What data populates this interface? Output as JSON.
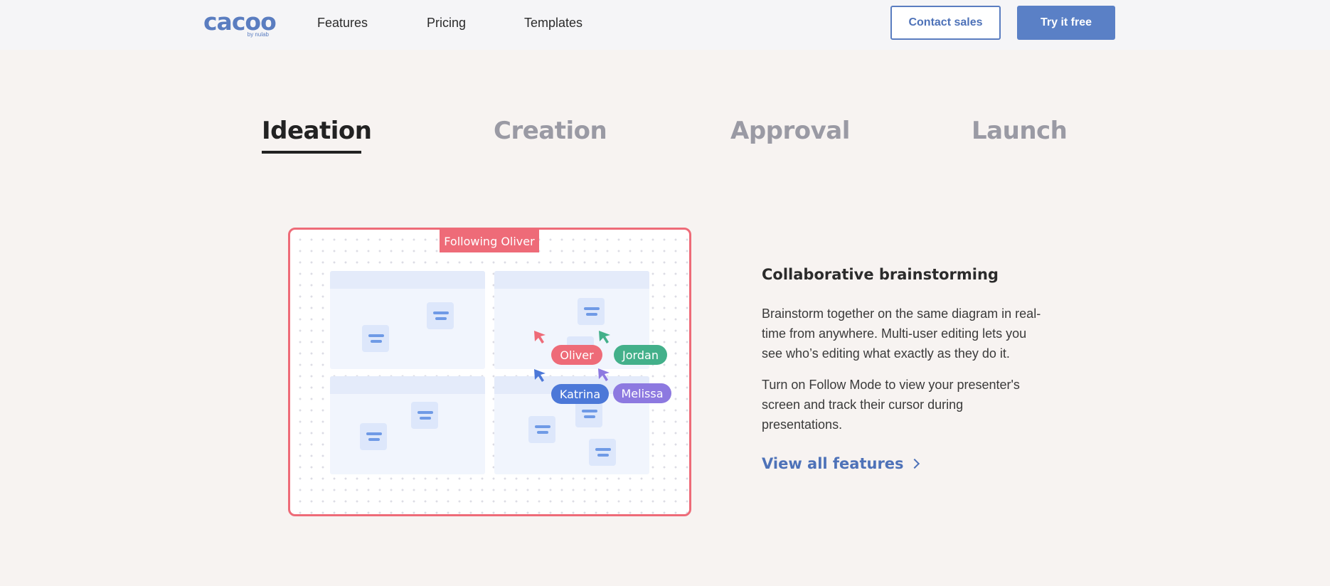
{
  "header": {
    "logo_text": "cacoo",
    "logo_sub": "by nulab",
    "nav": [
      "Features",
      "Pricing",
      "Templates"
    ],
    "contact_label": "Contact sales",
    "try_label": "Try it free"
  },
  "tabs": [
    {
      "label": "Ideation",
      "active": true
    },
    {
      "label": "Creation",
      "active": false
    },
    {
      "label": "Approval",
      "active": false
    },
    {
      "label": "Launch",
      "active": false
    }
  ],
  "illustration": {
    "follow_label": "Following Oliver",
    "users": [
      {
        "name": "Oliver",
        "color": "#ee6b78"
      },
      {
        "name": "Jordan",
        "color": "#43b08a"
      },
      {
        "name": "Katrina",
        "color": "#4c78d8"
      },
      {
        "name": "Melissa",
        "color": "#8d79e0"
      }
    ],
    "frame_color": "#ee6b78"
  },
  "feature": {
    "title": "Collaborative brainstorming",
    "paragraph1": "Brainstorm together on the same diagram in real-time from anywhere. Multi-user editing lets you see who’s editing what exactly as they do it.",
    "paragraph2": "Turn on Follow Mode to view your presenter's screen and track their cursor during presentations.",
    "link_label": "View all features"
  },
  "colors": {
    "brand": "#5a7dc0",
    "background": "#f7f3f1"
  }
}
